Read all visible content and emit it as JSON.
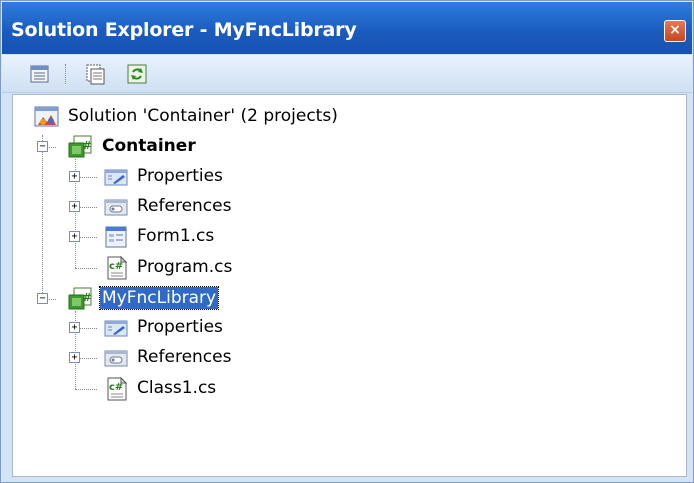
{
  "window": {
    "title": "Solution Explorer - MyFncLibrary",
    "close_glyph": "×"
  },
  "toolbar": {
    "buttons": [
      {
        "icon": "properties-icon"
      },
      {
        "icon": "show-all-files-icon"
      },
      {
        "icon": "refresh-icon"
      }
    ]
  },
  "tree": {
    "solution": {
      "label": "Solution 'Container' (2 projects)",
      "icon": "solution-icon"
    },
    "projects": [
      {
        "label": "Container",
        "icon": "csharp-project-icon",
        "expanded": true,
        "children": [
          {
            "label": "Properties",
            "icon": "properties-folder-icon",
            "expandable": true
          },
          {
            "label": "References",
            "icon": "references-folder-icon",
            "expandable": true
          },
          {
            "label": "Form1.cs",
            "icon": "form-icon",
            "expandable": true
          },
          {
            "label": "Program.cs",
            "icon": "csharp-file-icon",
            "expandable": false
          }
        ]
      },
      {
        "label": "MyFncLibrary",
        "icon": "csharp-project-icon",
        "expanded": true,
        "selected": true,
        "children": [
          {
            "label": "Properties",
            "icon": "properties-folder-icon",
            "expandable": true
          },
          {
            "label": "References",
            "icon": "references-folder-icon",
            "expandable": true
          },
          {
            "label": "Class1.cs",
            "icon": "csharp-file-icon",
            "expandable": false
          }
        ]
      }
    ],
    "expander_plus": "+",
    "expander_minus": "−"
  },
  "colors": {
    "titlebar": "#1b5cbf",
    "selection": "#316ac5",
    "csharp_green": "#3a9a2a"
  }
}
